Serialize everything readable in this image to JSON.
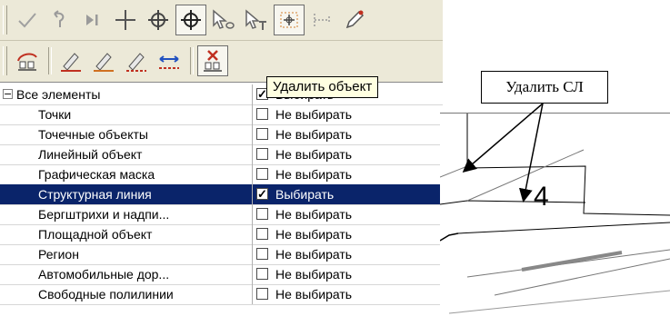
{
  "toolbar1": {
    "icons": [
      "apply-icon",
      "undo-curve-icon",
      "step-to-end-icon",
      "crosshair-plus-icon",
      "crosshair-circle-icon",
      "crosshair-circle-pressed-icon",
      "select-point-icon",
      "select-text-icon",
      "snap-grid-icon",
      "snap-points-icon",
      "pencil-point-icon"
    ]
  },
  "toolbar2": {
    "icons": [
      "insert-object-icon",
      "draw-line-icon",
      "draw-line-alt-icon",
      "draw-line-erase-icon",
      "move-points-icon",
      "delete-object-icon"
    ]
  },
  "tooltip": {
    "text": "Удалить объект"
  },
  "tree": {
    "rows": [
      {
        "name": "Все элементы",
        "checked": true,
        "value": "Выбирать",
        "selected": false,
        "root": true
      },
      {
        "name": "Точки",
        "checked": false,
        "value": "Не выбирать",
        "selected": false
      },
      {
        "name": "Точечные объекты",
        "checked": false,
        "value": "Не выбирать",
        "selected": false
      },
      {
        "name": "Линейный объект",
        "checked": false,
        "value": "Не выбирать",
        "selected": false
      },
      {
        "name": "Графическая маска",
        "checked": false,
        "value": "Не выбирать",
        "selected": false
      },
      {
        "name": "Структурная линия",
        "checked": true,
        "value": "Выбирать",
        "selected": true
      },
      {
        "name": "Бергштрихи и надпи...",
        "checked": false,
        "value": "Не выбирать",
        "selected": false
      },
      {
        "name": "Площадной объект",
        "checked": false,
        "value": "Не выбирать",
        "selected": false
      },
      {
        "name": "Регион",
        "checked": false,
        "value": "Не выбирать",
        "selected": false
      },
      {
        "name": "Автомобильные дор...",
        "checked": false,
        "value": "Не выбирать",
        "selected": false
      },
      {
        "name": "Свободные полилинии",
        "checked": false,
        "value": "Не выбирать",
        "selected": false
      }
    ]
  },
  "canvas": {
    "callout": "Удалить СЛ",
    "label": "4"
  },
  "colors": {
    "selection": "#0a246a",
    "panel": "#ece9d8",
    "tooltip_bg": "#ffffe1"
  }
}
